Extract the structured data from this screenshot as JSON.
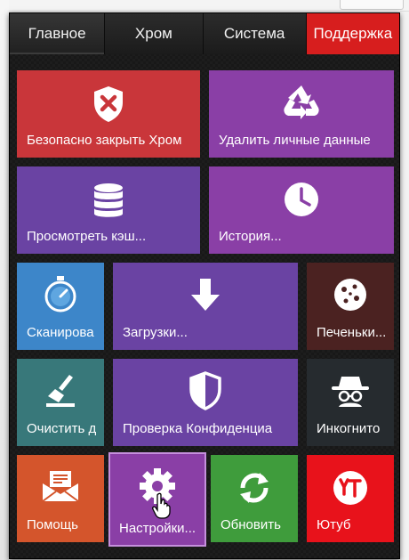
{
  "tabs": [
    {
      "label": "Главное"
    },
    {
      "label": "Хром"
    },
    {
      "label": "Система"
    },
    {
      "label": "Поддержка"
    }
  ],
  "tiles": {
    "safe_close": {
      "label": "Безопасно закрыть Хром",
      "icon": "shield-x-icon",
      "color": "#c9363a"
    },
    "clear_private": {
      "label": "Удалить личные данные",
      "icon": "recycle-icon",
      "color": "#8a3fa6"
    },
    "view_cache": {
      "label": "Просмотреть кэш...",
      "icon": "database-icon",
      "color": "#6a43a3"
    },
    "history": {
      "label": "История...",
      "icon": "clock-icon",
      "color": "#8a3fa6"
    },
    "scan": {
      "label": "Сканирова",
      "icon": "stopwatch-icon",
      "color": "#3d86c9"
    },
    "downloads": {
      "label": "Загрузки...",
      "icon": "download-arrow-icon",
      "color": "#6a43a3"
    },
    "cookies": {
      "label": "Печеньки...",
      "icon": "cookie-icon",
      "color": "#4b2221"
    },
    "cleanup": {
      "label": "Очистить д",
      "icon": "broom-icon",
      "color": "#38787a"
    },
    "privacy_check": {
      "label": "Проверка Конфиденциа",
      "icon": "shield-half-icon",
      "color": "#6a43a3"
    },
    "incognito": {
      "label": "Инкогнито",
      "icon": "spy-icon",
      "color": "#262b2f"
    },
    "help": {
      "label": "Помощь",
      "icon": "mail-icon",
      "color": "#d4552c"
    },
    "settings": {
      "label": "Настройки...",
      "icon": "gear-icon",
      "color": "#8a3fa6"
    },
    "update": {
      "label": "Обновить",
      "icon": "refresh-icon",
      "color": "#3f9c3c"
    },
    "youtube": {
      "label": "Ютуб",
      "icon": "youtube-icon",
      "color": "#e8121b"
    }
  }
}
